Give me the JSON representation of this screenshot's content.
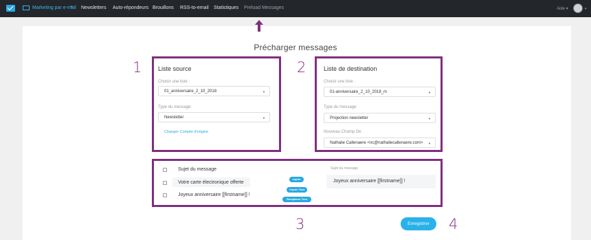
{
  "nav": {
    "brand": "Marketing par e-mail",
    "items": [
      "Newsletters",
      "Auto-répondeurs",
      "Brouillons",
      "RSS-to-email",
      "Statistiques",
      "Preload Messages"
    ],
    "help": "Aide"
  },
  "page_title": "Précharger messages",
  "annotations": [
    "1",
    "2",
    "3",
    "4"
  ],
  "source": {
    "title": "Liste source",
    "list_label": "Choisir une liste :",
    "list_value": "01_anniversaire_2_10_2018",
    "type_label": "Type du message:",
    "type_value": "Newsletter",
    "change_link": "Changer Compte d'origine"
  },
  "destination": {
    "title": "Liste de destination",
    "list_label": "Choisir une liste :",
    "list_value": "01-anniversaire_2_10_2018_m",
    "type_label": "Type du message:",
    "type_value": "Projection newsletter",
    "from_label": "Nouveau Champ De:",
    "from_value": "Nathalie Callenaere <nc@nathaliecallenaere.com>"
  },
  "messages": {
    "rows": [
      "Sujet du message",
      "Votre carte électronique offerte",
      "Joyeux anniversaire [[firstname]] !"
    ],
    "buttons": [
      "copier",
      "Copier Tout",
      "Remplacer Tout"
    ],
    "subject_label": "Sujet du message",
    "subject_value": "Joyeux anniversaire [[firstname]] !"
  },
  "save_label": "Enregistrer",
  "colors": {
    "accent": "#29b1ea",
    "annotation": "#7f2e7f",
    "nav_bg": "#23262b"
  }
}
